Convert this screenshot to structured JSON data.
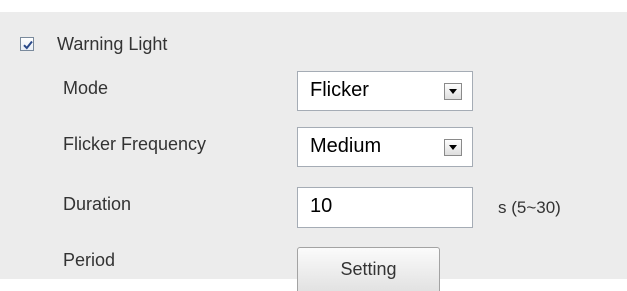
{
  "warning_light": {
    "checked": true,
    "label": "Warning Light"
  },
  "fields": {
    "mode": {
      "label": "Mode",
      "value": "Flicker"
    },
    "flicker_frequency": {
      "label": "Flicker Frequency",
      "value": "Medium"
    },
    "duration": {
      "label": "Duration",
      "value": "10",
      "hint": "s (5~30)"
    },
    "period": {
      "label": "Period",
      "button_label": "Setting"
    }
  },
  "icons": {
    "checkbox_check": "check-icon",
    "dropdown_arrow": "chevron-down-icon"
  },
  "colors": {
    "panel_background": "#ececec",
    "check_mark": "#2b4a8a"
  }
}
